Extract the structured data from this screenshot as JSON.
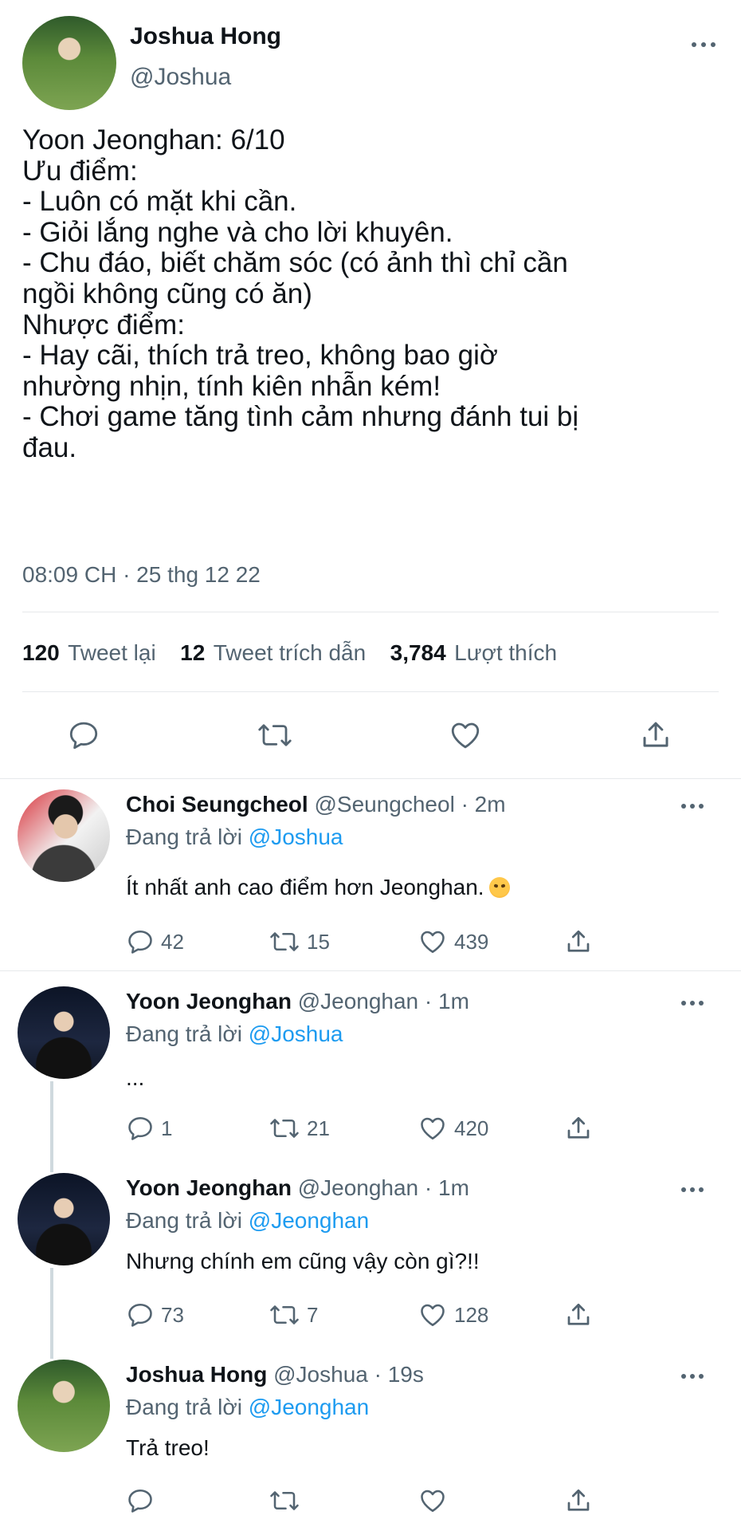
{
  "main_tweet": {
    "display_name": "Joshua Hong",
    "handle": "@Joshua",
    "text": "Yoon Jeonghan: 6/10\nƯu điểm:\n- Luôn có mặt khi cần.\n- Giỏi lắng nghe và cho lời khuyên.\n- Chu đáo, biết chăm sóc (có ảnh thì chỉ cần\nngồi không cũng có ăn)\nNhược điểm:\n- Hay cãi, thích trả treo, không bao giờ\nnhường nhịn, tính kiên nhẫn kém!\n- Chơi game tăng tình cảm nhưng đánh tui bị\nđau.",
    "timestamp": "08:09 CH · 25 thg 12 22",
    "stats": {
      "retweets_count": "120",
      "retweets_label": "Tweet lại",
      "quotes_count": "12",
      "quotes_label": "Tweet trích dẫn",
      "likes_count": "3,784",
      "likes_label": "Lượt thích"
    }
  },
  "replies": [
    {
      "display_name": "Choi Seungcheol",
      "handle": "@Seungcheol",
      "time": "· 2m",
      "replying_label": "Đang trả lời",
      "replying_to": "@Joshua",
      "text": "Ít nhất anh cao điểm hơn Jeonghan.",
      "emoji": "angry-face",
      "replies": "42",
      "retweets": "15",
      "likes": "439"
    },
    {
      "display_name": "Yoon Jeonghan",
      "handle": "@Jeonghan",
      "time": "· 1m",
      "replying_label": "Đang trả lời",
      "replying_to": "@Joshua",
      "text": "...",
      "replies": "1",
      "retweets": "21",
      "likes": "420"
    },
    {
      "display_name": "Yoon Jeonghan",
      "handle": "@Jeonghan",
      "time": "· 1m",
      "replying_label": "Đang trả lời",
      "replying_to": "@Jeonghan",
      "text": "Nhưng chính em cũng vậy còn gì?!!",
      "replies": "73",
      "retweets": "7",
      "likes": "128"
    },
    {
      "display_name": "Joshua Hong",
      "handle": "@Joshua",
      "time": "· 19s",
      "replying_label": "Đang trả lời",
      "replying_to": "@Jeonghan",
      "text": "Trả treo!",
      "replies": "",
      "retweets": "",
      "likes": ""
    }
  ],
  "colors": {
    "text": "#0f1419",
    "secondary": "#536471",
    "link": "#1d9bf0",
    "divider": "#e6e9eb"
  },
  "icons": [
    "more-icon",
    "reply-icon",
    "retweet-icon",
    "like-icon",
    "share-icon"
  ]
}
